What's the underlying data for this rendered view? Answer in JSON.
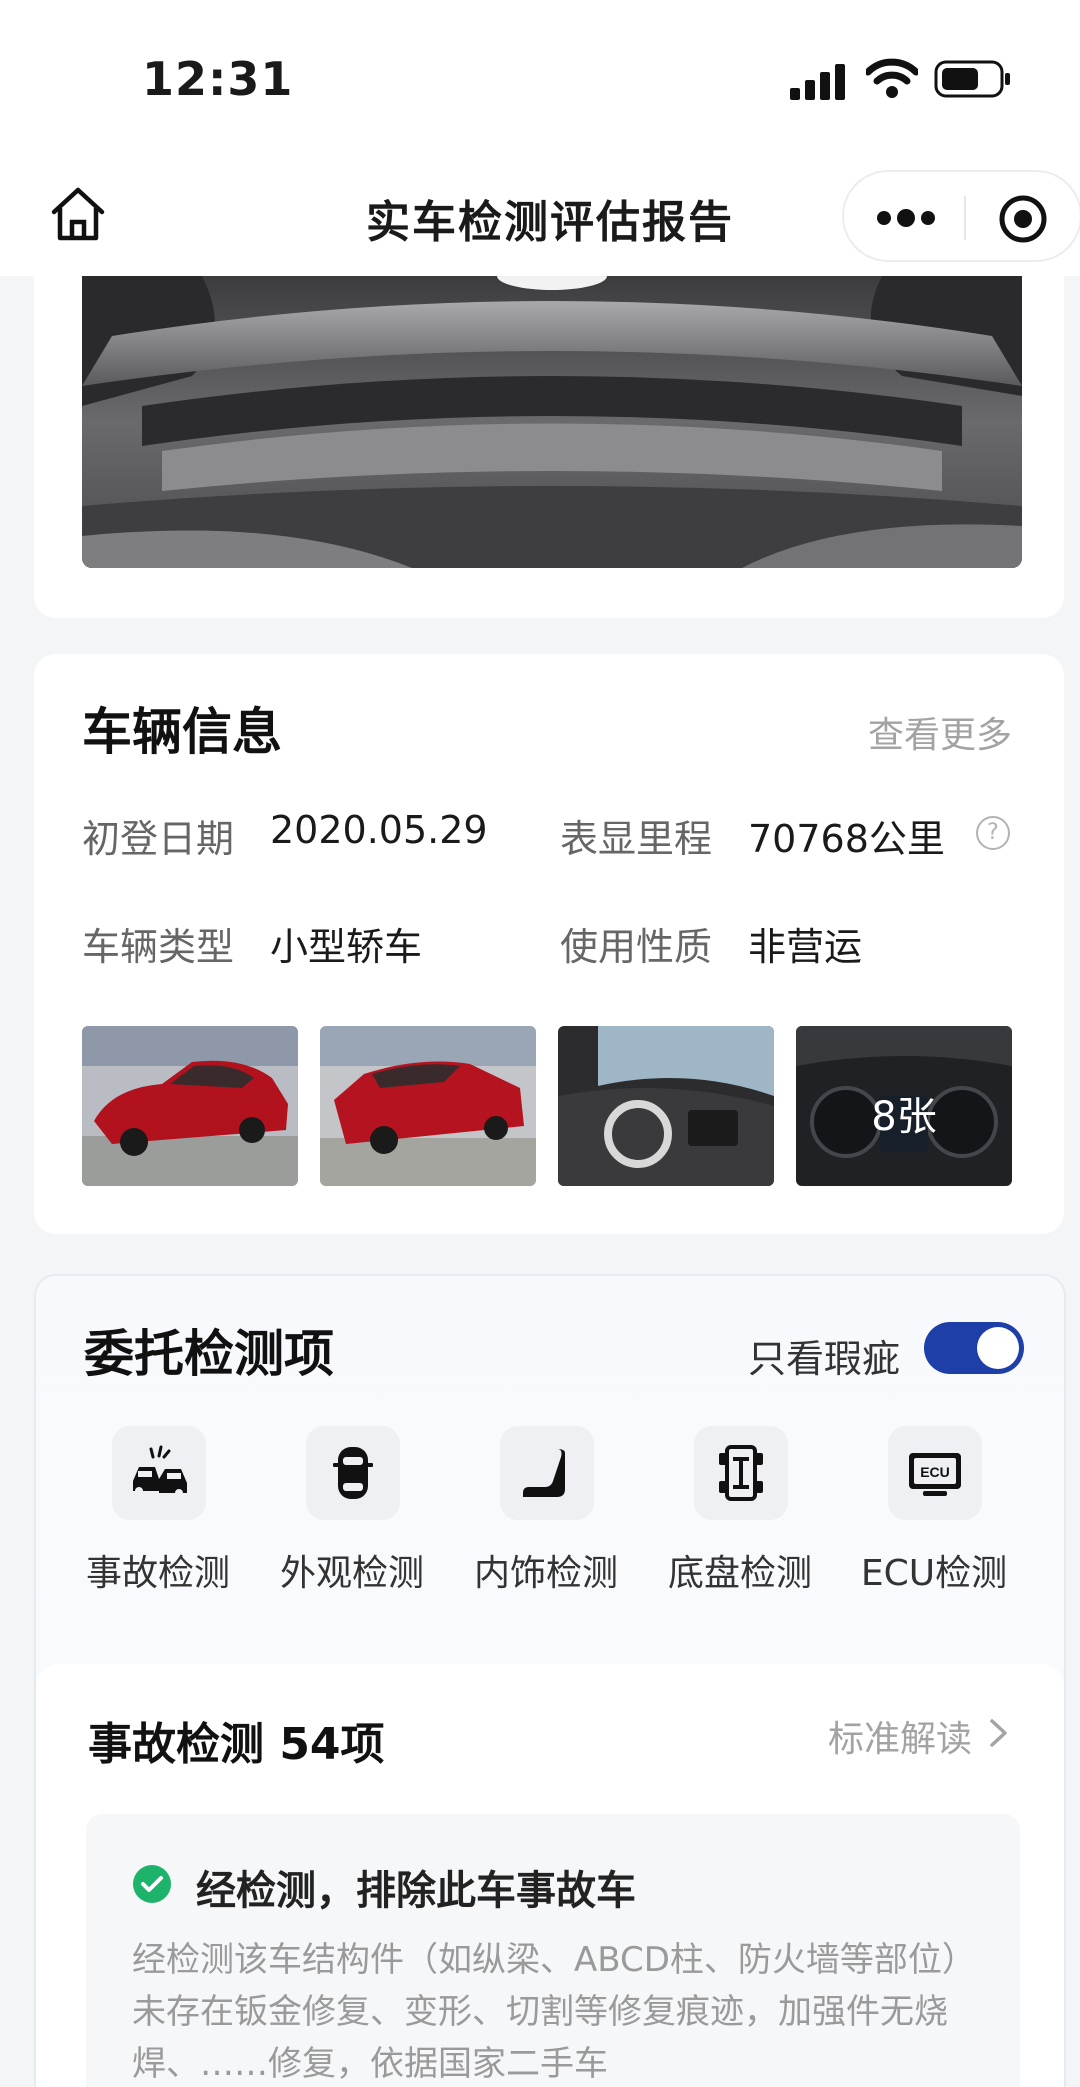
{
  "status_bar": {
    "time": "12:31"
  },
  "nav": {
    "title": "实车检测评估报告"
  },
  "vehicle_info": {
    "title": "车辆信息",
    "more_link": "查看更多",
    "first_registration_label": "初登日期",
    "first_registration_value": "2020.05.29",
    "mileage_label": "表显里程",
    "mileage_value": "70768公里",
    "help_glyph": "?",
    "vehicle_type_label": "车辆类型",
    "vehicle_type_value": "小型轿车",
    "usage_label": "使用性质",
    "usage_value": "非营运",
    "photo_count": "8张"
  },
  "inspection": {
    "title": "委托检测项",
    "filter_label": "只看瑕疵",
    "filter_on": true,
    "categories": [
      {
        "label": "事故检测",
        "icon": "car-crash-icon"
      },
      {
        "label": "外观检测",
        "icon": "car-top-icon"
      },
      {
        "label": "内饰检测",
        "icon": "seat-icon"
      },
      {
        "label": "底盘检测",
        "icon": "chassis-icon"
      },
      {
        "label": "ECU检测",
        "icon": "ecu-icon"
      }
    ],
    "ecu_icon_text": "ECU",
    "accident": {
      "title": "事故检测 54项",
      "link": "标准解读",
      "result_title": "经检测，排除此车事故车",
      "result_desc": "经检测该车结构件（如纵梁、ABCD柱、防火墙等部位）未存在钣金修复、变形、切割等修复痕迹，加强件无烧焊、……修复，依据国家二手车"
    }
  },
  "colors": {
    "accent": "#1e3fa8",
    "success": "#1db36a"
  }
}
